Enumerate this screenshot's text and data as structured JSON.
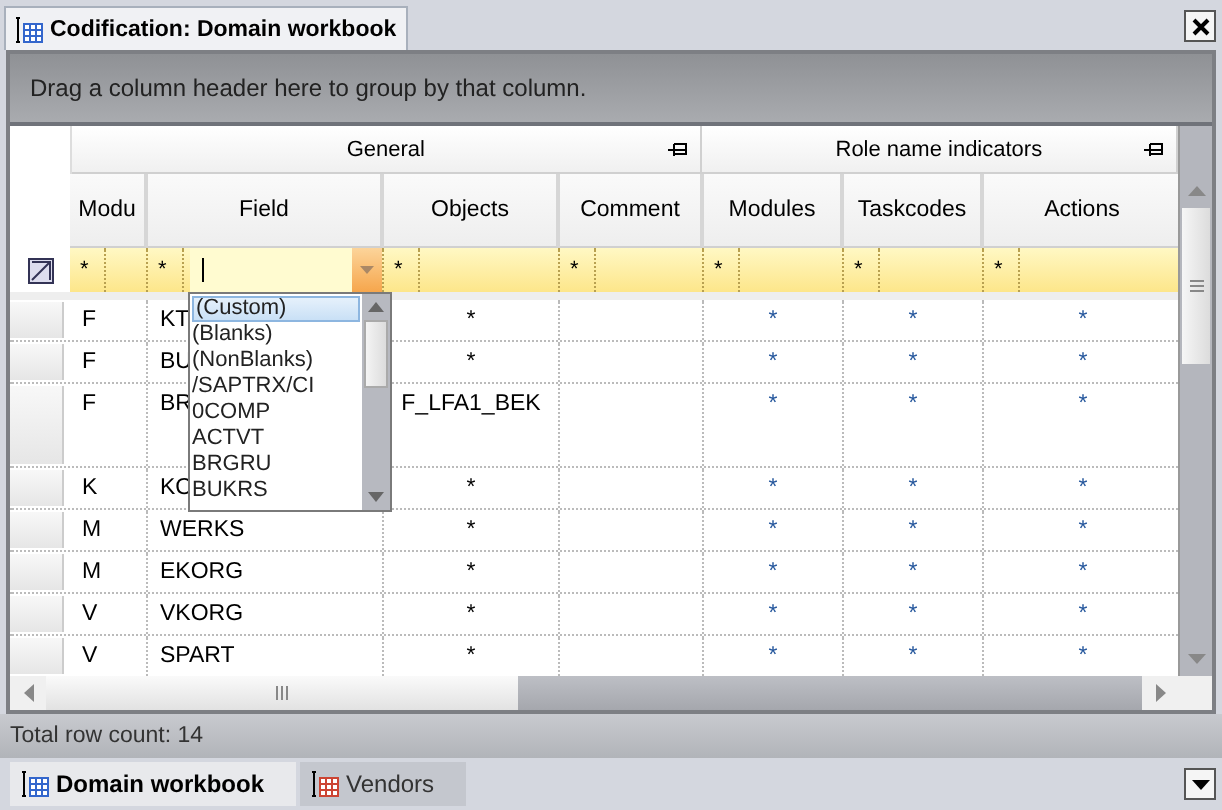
{
  "tab": {
    "title": "Codification: Domain workbook"
  },
  "group_panel": {
    "hint": "Drag a column header here to group by that column."
  },
  "bands": [
    {
      "label": "General",
      "columns": [
        {
          "label": "Modu",
          "filter_operator": "*"
        },
        {
          "label": "Field",
          "filter_operator": "*",
          "filter_dropdown": true
        },
        {
          "label": "Objects",
          "filter_operator": "*"
        },
        {
          "label": "Comment",
          "filter_operator": "*"
        }
      ]
    },
    {
      "label": "Role name indicators",
      "columns": [
        {
          "label": "Modules",
          "filter_operator": "*"
        },
        {
          "label": "Taskcodes",
          "filter_operator": "*"
        },
        {
          "label": "Actions",
          "filter_operator": "*"
        }
      ]
    }
  ],
  "filter_dropdown": {
    "items": [
      {
        "label": "(Custom)",
        "selected": true
      },
      {
        "label": "(Blanks)",
        "selected": false
      },
      {
        "label": "(NonBlanks)",
        "selected": false
      },
      {
        "label": "/SAPTRX/CI",
        "selected": false
      },
      {
        "label": "0COMP",
        "selected": false
      },
      {
        "label": "ACTVT",
        "selected": false
      },
      {
        "label": "BRGRU",
        "selected": false
      },
      {
        "label": "BUKRS",
        "selected": false
      }
    ]
  },
  "rows": [
    {
      "cells": [
        "F",
        "KT",
        "*",
        "",
        "*",
        "*",
        "*"
      ]
    },
    {
      "cells": [
        "F",
        "BU",
        "*",
        "",
        "*",
        "*",
        "*"
      ]
    },
    {
      "cells": [
        "F",
        "BR",
        "F_LFA1_BEK",
        "",
        "*",
        "*",
        "*"
      ]
    },
    {
      "cells": [
        "K",
        "KO",
        "*",
        "",
        "*",
        "*",
        "*"
      ]
    },
    {
      "cells": [
        "M",
        "WERKS",
        "*",
        "",
        "*",
        "*",
        "*"
      ]
    },
    {
      "cells": [
        "M",
        "EKORG",
        "*",
        "",
        "*",
        "*",
        "*"
      ]
    },
    {
      "cells": [
        "V",
        "VKORG",
        "*",
        "",
        "*",
        "*",
        "*"
      ]
    },
    {
      "cells": [
        "V",
        "SPART",
        "*",
        "",
        "*",
        "*",
        "*"
      ]
    }
  ],
  "status_bar": {
    "text": "Total row count: 14"
  },
  "bottom_tabs": [
    {
      "label": "Domain workbook",
      "selected": true
    },
    {
      "label": "Vendors",
      "selected": false
    }
  ]
}
